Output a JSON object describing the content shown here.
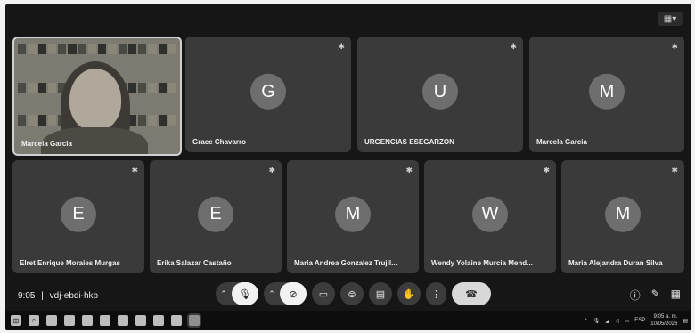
{
  "meeting": {
    "time": "9:05",
    "separator": "|",
    "code": "vdj-ebdi-hkb"
  },
  "self_tile": {
    "name": "Marcela Garcia"
  },
  "participants": [
    {
      "initial": "G",
      "name": "Grace Chavarro"
    },
    {
      "initial": "U",
      "name": "URGENCIAS ESEGARZON"
    },
    {
      "initial": "M",
      "name": "Marcela Garcia"
    },
    {
      "initial": "E",
      "name": "Elret Enrique Moraies Murgas"
    },
    {
      "initial": "E",
      "name": "Erika Salazar Castaño"
    },
    {
      "initial": "M",
      "name": "Maria Andrea Gonzalez Trujil..."
    },
    {
      "initial": "W",
      "name": "Wendy Yolaine Murcia Mend..."
    },
    {
      "initial": "M",
      "name": "Maria Alejandra Duran Silva"
    }
  ],
  "controls": {
    "mic_icon": "mic-off-icon",
    "camera_icon": "camera-off-icon",
    "present_icon": "present-icon",
    "captions_icon": "captions-icon",
    "chat_icon": "chat-icon",
    "hand_icon": "raise-hand-icon",
    "more_icon": "more-icon",
    "end_icon": "hang-up-icon"
  },
  "taskbar": {
    "language": "ESP",
    "clock_time": "9:05 a. m.",
    "clock_date": "10/05/2026"
  }
}
